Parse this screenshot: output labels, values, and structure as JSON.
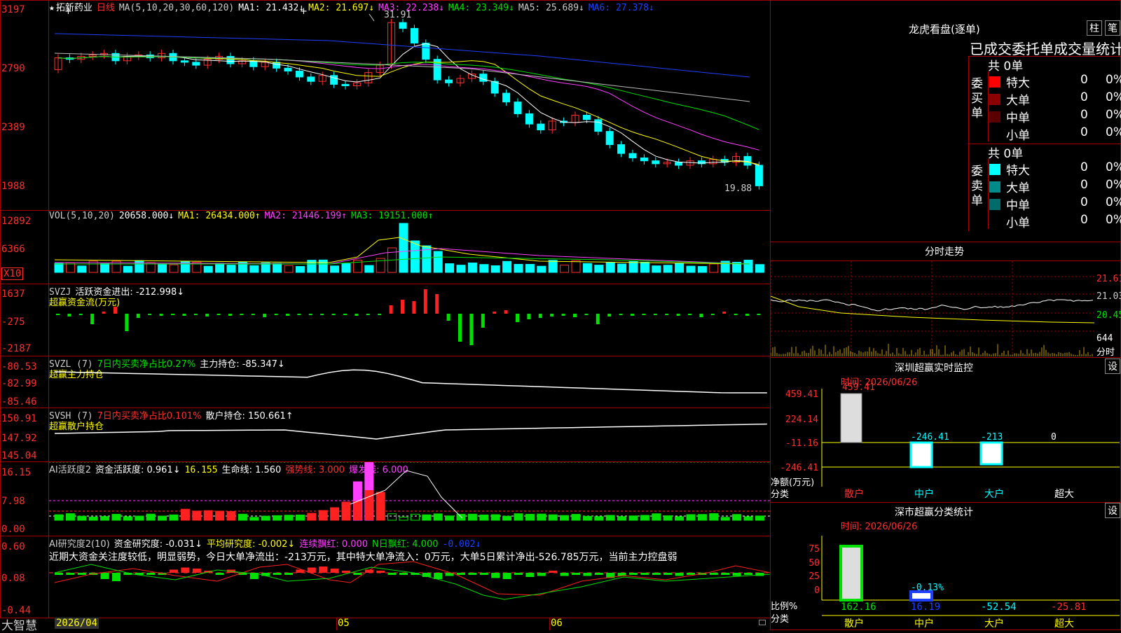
{
  "kline": {
    "star": "★",
    "stock_name": "拓新药业",
    "period": "日线",
    "ma_params": "MA(5,10,20,30,60,120)",
    "ma1": "MA1: 21.432↓",
    "ma2": "MA2: 21.697↓",
    "ma3": "MA3: 22.238↓",
    "ma4": "MA4: 23.349↓",
    "ma5": "MA5: 25.689↓",
    "ma6": "MA6: 27.378↓",
    "high_label": "31.91",
    "low_label": "19.88",
    "axis": [
      "3197",
      "2790",
      "2389",
      "1988"
    ]
  },
  "vol": {
    "name": "VOL(5,10,20)",
    "value": "20658.000↓",
    "ma1": "MA1: 26434.000↑",
    "ma2": "MA2: 21446.199↑",
    "ma3": "MA3: 19151.000↑",
    "axis": [
      "12892",
      "6366"
    ],
    "unit": "X10"
  },
  "svzj": {
    "name": "SVZJ",
    "label": "活跃资金进出: -212.998↓",
    "sub": "超赢资金流(万元)",
    "axis": [
      "1637",
      "-275",
      "-2187"
    ]
  },
  "svzl": {
    "name": "SVZL (7)",
    "net": "7日内买卖净占比0.27%",
    "hold": "主力持仓: -85.347↓",
    "sub": "超赢主力持仓",
    "axis": [
      "-80.53",
      "-82.99",
      "-85.46"
    ]
  },
  "svsh": {
    "name": "SVSH (7)",
    "net": "7日内买卖净占比0.101%",
    "hold": "散户持仓: 150.661↑",
    "sub": "超赢散户持仓",
    "axis": [
      "150.91",
      "147.92",
      "145.04"
    ]
  },
  "ai_active": {
    "name": "AI活跃度2",
    "label": "资金活跃度: 0.961↓",
    "v2": "16.155",
    "life": "生命线: 1.560",
    "strong": "强势线: 3.000",
    "burst": "爆发线: 6.000",
    "axis": [
      "16.15",
      "7.98",
      "0.00"
    ]
  },
  "ai_research": {
    "name": "AI研究度2(10)",
    "label": "资金研究度: -0.031↓",
    "avg": "平均研究度: -0.002↓",
    "lianxu": "连续飘红: 0.000",
    "nday": "N日飘红: 4.000",
    "last": "-0.002↓",
    "comment": "近期大资金关注度较低，明显弱势，今日大单净流出：-213万元，其中特大单净流入：0万元，大单5日累计净出-526.785万元，当前主力控盘弱",
    "axis": [
      "0.60",
      "0.08",
      "-0.44"
    ]
  },
  "bottom": {
    "brand": "大智慧",
    "dates": [
      "2026/04",
      "05",
      "06"
    ]
  },
  "dragon": {
    "title": "龙虎看盘(逐单)",
    "btn1": "柱",
    "btn2": "笔",
    "header": "已成交委托单成交量统计",
    "buy_label": "委买单",
    "sell_label": "委卖单",
    "buy_total": "共 0单",
    "sell_total": "共 0单",
    "buy_rows": [
      {
        "label": "特大",
        "count": "0",
        "pct": "0%",
        "color": "#ff0000"
      },
      {
        "label": "大单",
        "count": "0",
        "pct": "0%",
        "color": "#8b0000"
      },
      {
        "label": "中单",
        "count": "0",
        "pct": "0%",
        "color": "#5a0000"
      },
      {
        "label": "小单",
        "count": "0",
        "pct": "0%",
        "color": "#000000"
      }
    ],
    "sell_rows": [
      {
        "label": "特大",
        "count": "0",
        "pct": "0%",
        "color": "#00ffff"
      },
      {
        "label": "大单",
        "count": "0",
        "pct": "0%",
        "color": "#008b8b"
      },
      {
        "label": "中单",
        "count": "0",
        "pct": "0%",
        "color": "#006b6b"
      },
      {
        "label": "小单",
        "count": "0",
        "pct": "0%",
        "color": "#000000"
      }
    ]
  },
  "intraday": {
    "title": "分时走势",
    "axis": [
      "21.61",
      "21.03",
      "20.45"
    ],
    "vol_label": "644",
    "unit": "分时"
  },
  "sz_monitor": {
    "title": "深圳超赢实时监控",
    "btn": "设",
    "time": "时间: 2026/06/26",
    "axis": [
      "459.41",
      "224.14",
      "-11.16",
      "-246.41"
    ],
    "values": [
      "459.41",
      "-246.41",
      "-213",
      "0"
    ],
    "ylabel": "净额(万元)",
    "xlabel": "分类",
    "cats": [
      "散户",
      "中户",
      "大户",
      "超大"
    ]
  },
  "sz_class": {
    "title": "深市超赢分类统计",
    "btn": "设",
    "time": "时间: 2026/06/26",
    "axis": [
      "75",
      "50",
      "25",
      "0"
    ],
    "bar_label": "-0.13%",
    "values": [
      "162.16",
      "16.19",
      "-52.54",
      "-25.81"
    ],
    "ylabel": "比例%",
    "xlabel": "分类",
    "cats": [
      "散户",
      "中户",
      "大户",
      "超大"
    ]
  }
}
